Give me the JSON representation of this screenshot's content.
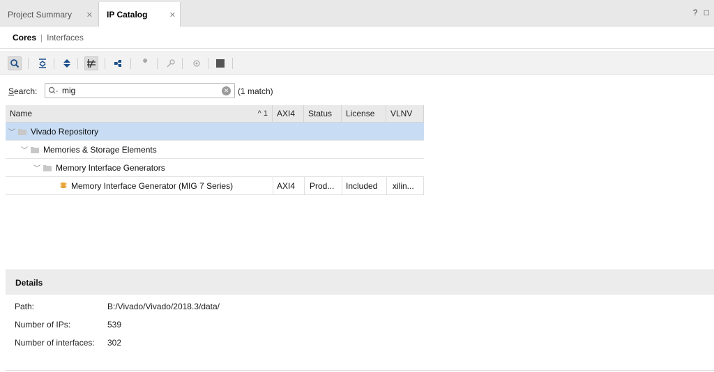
{
  "tabs": [
    {
      "label": "Project Summary",
      "active": false
    },
    {
      "label": "IP Catalog",
      "active": true
    }
  ],
  "window_controls": "? □",
  "subtabs": {
    "active": "Cores",
    "separator": "|",
    "other": "Interfaces"
  },
  "toolbar": {
    "icons": [
      "search-icon",
      "collapse-all-icon",
      "expand-all-icon",
      "toggle-pin-icon",
      "add-repository-icon",
      "customize-ip-icon",
      "license-key-icon",
      "ip-settings-icon",
      "stop-icon",
      "settings-icon"
    ]
  },
  "search": {
    "label_first": "S",
    "label_rest": "earch:",
    "value": "mig",
    "match_text": "(1 match)"
  },
  "table": {
    "columns": [
      "Name",
      "AXI4",
      "Status",
      "License",
      "VLNV"
    ],
    "sort_indicator": "^ 1",
    "rows": [
      {
        "level": 0,
        "type": "folder",
        "name": "Vivado Repository",
        "axi4": "",
        "status": "",
        "license": "",
        "vlnv": "",
        "selected": true
      },
      {
        "level": 1,
        "type": "folder",
        "name": "Memories & Storage Elements",
        "axi4": "",
        "status": "",
        "license": "",
        "vlnv": "",
        "selected": false
      },
      {
        "level": 2,
        "type": "folder",
        "name": "Memory Interface Generators",
        "axi4": "",
        "status": "",
        "license": "",
        "vlnv": "",
        "selected": false
      },
      {
        "level": 3,
        "type": "ip",
        "name": "Memory Interface Generator (MIG 7 Series)",
        "axi4": "AXI4",
        "status": "Prod...",
        "license": "Included",
        "vlnv": "xilin...",
        "selected": false
      }
    ]
  },
  "details": {
    "title": "Details",
    "rows": [
      {
        "label": "Path:",
        "value": "B:/Vivado/Vivado/2018.3/data/"
      },
      {
        "label": "Number of IPs:",
        "value": "539"
      },
      {
        "label": "Number of interfaces:",
        "value": "302"
      }
    ]
  },
  "colors": {
    "selected_row": "#c8ddf4",
    "folder": "#c8c8c8",
    "ip_icon": "#e8a33a"
  }
}
